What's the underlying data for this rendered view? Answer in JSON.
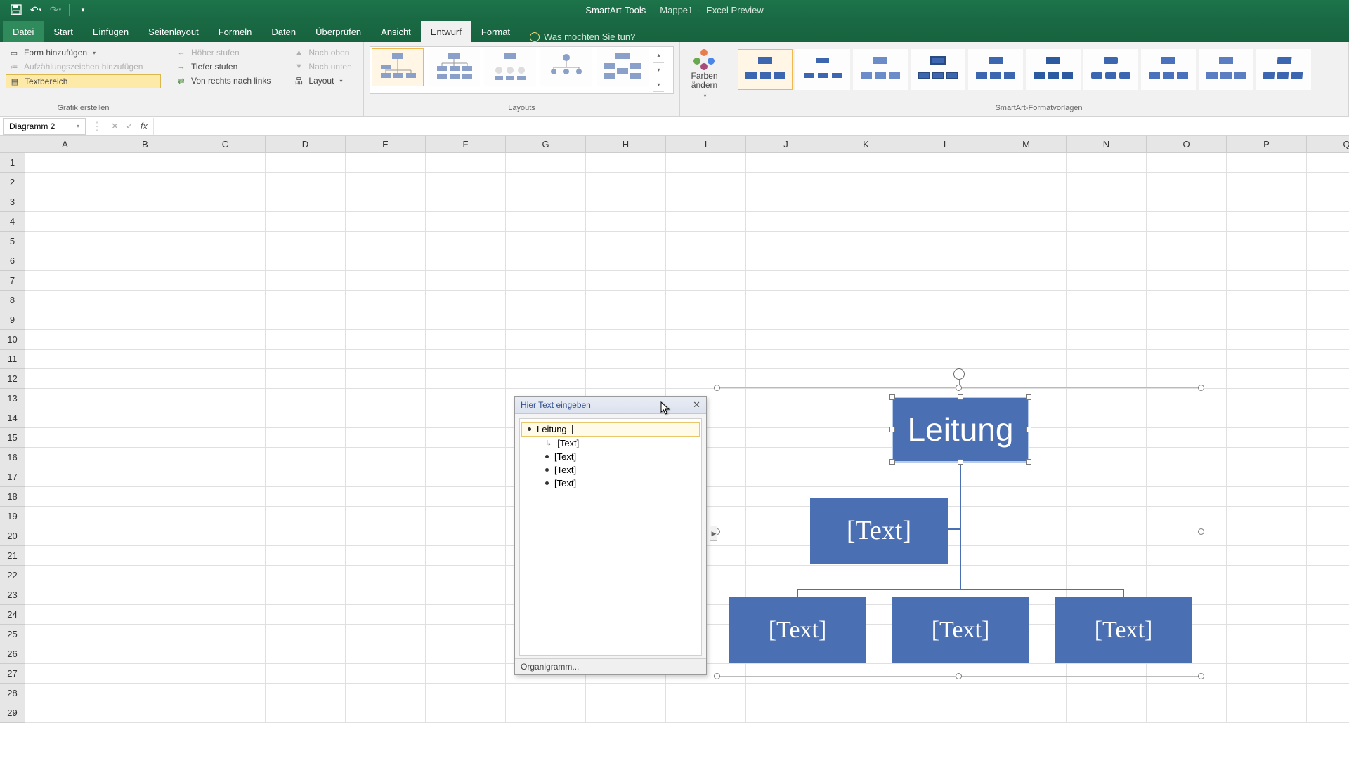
{
  "titlebar": {
    "tool_context": "SmartArt-Tools",
    "doc": "Mappe1",
    "app": "Excel Preview"
  },
  "tabs": {
    "datei": "Datei",
    "start": "Start",
    "einfuegen": "Einfügen",
    "seitenlayout": "Seitenlayout",
    "formeln": "Formeln",
    "daten": "Daten",
    "ueberpruefen": "Überprüfen",
    "ansicht": "Ansicht",
    "entwurf": "Entwurf",
    "format": "Format",
    "tellme": "Was möchten Sie tun?"
  },
  "ribbon": {
    "create": {
      "add_shape": "Form hinzufügen",
      "add_bullet": "Aufzählungszeichen hinzufügen",
      "text_pane": "Textbereich",
      "promote": "Höher stufen",
      "demote": "Tiefer stufen",
      "rtl": "Von rechts nach links",
      "up": "Nach oben",
      "down": "Nach unten",
      "layout_btn": "Layout",
      "group": "Grafik erstellen"
    },
    "layouts": {
      "group": "Layouts"
    },
    "colors": {
      "label": "Farben ändern"
    },
    "styles": {
      "group": "SmartArt-Formatvorlagen"
    }
  },
  "namebox": {
    "value": "Diagramm 2"
  },
  "columns": [
    "A",
    "B",
    "C",
    "D",
    "E",
    "F",
    "G",
    "H",
    "I",
    "J",
    "K",
    "L",
    "M",
    "N",
    "O",
    "P",
    "Q"
  ],
  "rows": [
    "1",
    "2",
    "3",
    "4",
    "5",
    "6",
    "7",
    "8",
    "9",
    "10",
    "11",
    "12",
    "13",
    "14",
    "15",
    "16",
    "17",
    "18",
    "19",
    "20",
    "21",
    "22",
    "23",
    "24",
    "25",
    "26",
    "27",
    "28",
    "29"
  ],
  "textpane": {
    "title": "Hier Text eingeben",
    "items": {
      "i0": "Leitung",
      "i1": "[Text]",
      "i2": "[Text]",
      "i3": "[Text]",
      "i4": "[Text]"
    },
    "footer": "Organigramm..."
  },
  "smartart": {
    "top": "Leitung",
    "mid": "[Text]",
    "b1": "[Text]",
    "b2": "[Text]",
    "b3": "[Text]"
  }
}
